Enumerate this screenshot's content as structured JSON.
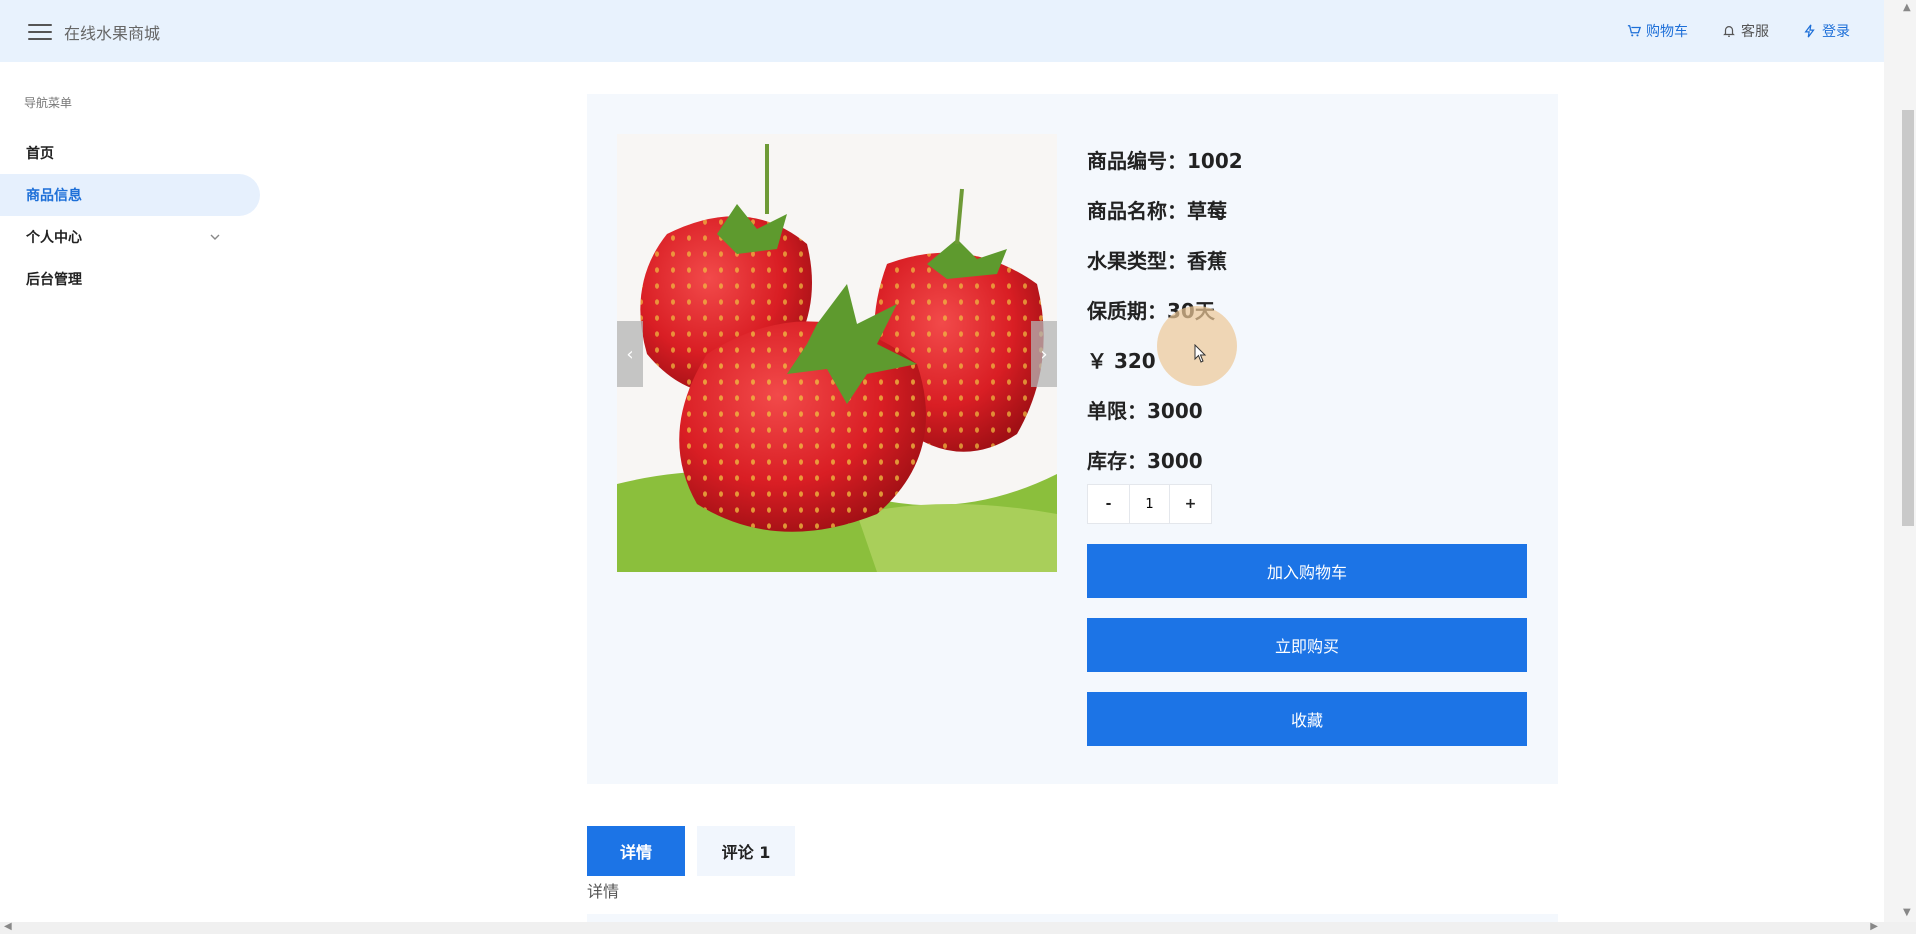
{
  "header": {
    "brand": "在线水果商城",
    "actions": [
      {
        "label": "购物车",
        "icon": "cart-icon"
      },
      {
        "label": "客服",
        "icon": "bell-icon"
      },
      {
        "label": "登录",
        "icon": "bolt-icon"
      }
    ]
  },
  "sidebar": {
    "heading": "导航菜单",
    "items": [
      {
        "label": "首页"
      },
      {
        "label": "商品信息",
        "active": true
      },
      {
        "label": "个人中心",
        "expandable": true
      },
      {
        "label": "后台管理"
      }
    ]
  },
  "product": {
    "fields": [
      "商品编号：1002",
      "商品名称：草莓",
      "水果类型：香蕉",
      "保质期：30天",
      "￥ 320",
      "单限：3000",
      "库存：3000"
    ],
    "quantity": "1",
    "stepper_minus": "-",
    "stepper_plus": "+",
    "carousel_prev": "‹",
    "carousel_next": "›",
    "buttons": {
      "add_to_cart": "加入购物车",
      "buy_now": "立即购买",
      "favorite": "收藏"
    }
  },
  "tabs": [
    {
      "label": "详情",
      "active": true
    },
    {
      "label": "评论 1",
      "active": false
    }
  ],
  "tab_caption": "详情",
  "colors": {
    "accent": "#1c74e6",
    "topbar_bg": "#e8f2fd",
    "panel_bg": "#f4f8fd"
  }
}
